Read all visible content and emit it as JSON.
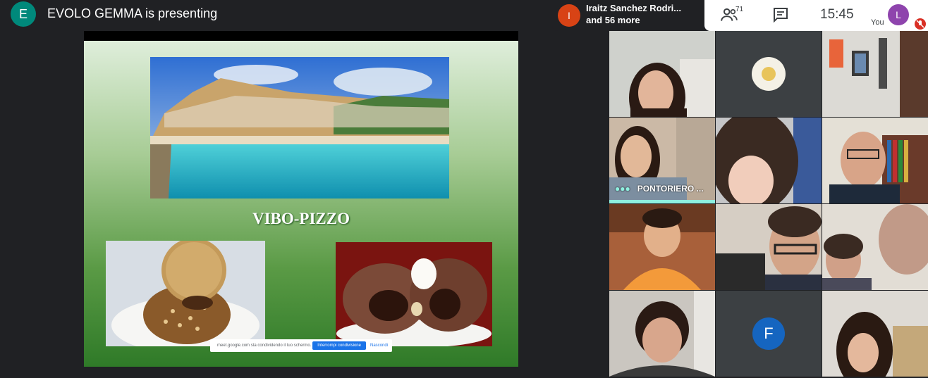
{
  "header": {
    "presenter_initial": "E",
    "presenter_text": "EVOLO GEMMA is presenting"
  },
  "participants_chip": {
    "avatar_initial": "I",
    "name": "Iraitz Sanchez Rodri...",
    "more": "and 56 more"
  },
  "controls": {
    "people_count": "71",
    "time": "15:45",
    "self_initial": "L",
    "self_label": "You"
  },
  "slide": {
    "title": "VIBO-PIZZO"
  },
  "share_bar": {
    "text": "meet.google.com sta condividendo il tuo schermo.",
    "stop_label": "Interrompi condivisione",
    "hide_label": "Nascondi"
  },
  "tiles": [
    {
      "name": ""
    },
    {
      "name": ""
    },
    {
      "name": ""
    },
    {
      "name": "PONTORIERO ..."
    },
    {
      "name": ""
    },
    {
      "name": ""
    },
    {
      "name": ""
    },
    {
      "name": ""
    },
    {
      "name": ""
    },
    {
      "name": ""
    },
    {
      "initial": "F"
    },
    {
      "name": ""
    }
  ],
  "colors": {
    "background": "#202124",
    "presenter_avatar": "#00897b",
    "chip_avatar": "#d84315",
    "self_avatar": "#8e44ad",
    "speaking_indicator": "#8ff0e0",
    "stop_button": "#1a73e8"
  }
}
